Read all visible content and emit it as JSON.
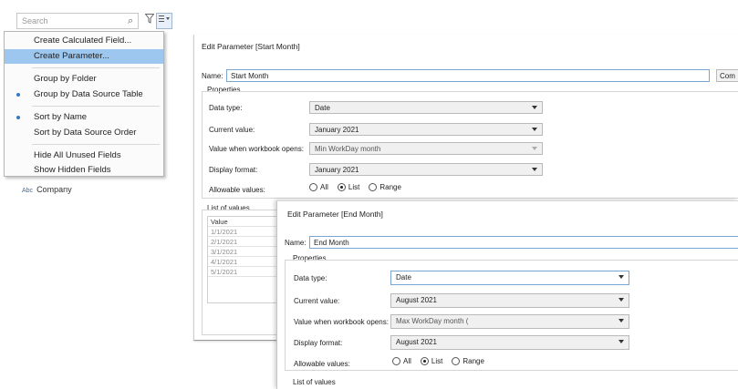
{
  "data_pane": {
    "search_placeholder": "Search",
    "search_icon": "magnifier-icon",
    "filter_icon": "filter-icon",
    "menu_icon": "list-menu-icon",
    "field": {
      "type_badge": "Abc",
      "name": "Company"
    }
  },
  "context_menu": {
    "items": [
      {
        "label": "Create Calculated Field...",
        "highlighted": false,
        "checked": false
      },
      {
        "label": "Create Parameter...",
        "highlighted": true,
        "checked": false
      },
      {
        "label": "Group by Folder",
        "highlighted": false,
        "checked": false
      },
      {
        "label": "Group by Data Source Table",
        "highlighted": false,
        "checked": true
      },
      {
        "label": "Sort by Name",
        "highlighted": false,
        "checked": true
      },
      {
        "label": "Sort by Data Source Order",
        "highlighted": false,
        "checked": false
      },
      {
        "label": "Hide All Unused Fields",
        "highlighted": false,
        "checked": false
      },
      {
        "label": "Show Hidden Fields",
        "highlighted": false,
        "checked": false
      }
    ]
  },
  "dialog_start": {
    "title": "Edit Parameter [Start Month]",
    "name_label": "Name:",
    "name_value": "Start Month",
    "comment_button": "Com",
    "properties_label": "Properties",
    "data_type_label": "Data type:",
    "data_type_value": "Date",
    "current_value_label": "Current value:",
    "current_value": "January 2021",
    "workbook_opens_label": "Value when workbook opens:",
    "workbook_opens_value": "Min WorkDay month",
    "display_format_label": "Display format:",
    "display_format_value": "January 2021",
    "allowable_label": "Allowable values:",
    "allowable_options": [
      "All",
      "List",
      "Range"
    ],
    "allowable_selected": "List",
    "list_of_values_label": "List of values",
    "list_header": "Value",
    "list_values": [
      "1/1/2021",
      "2/1/2021",
      "3/1/2021",
      "4/1/2021",
      "5/1/2021"
    ]
  },
  "dialog_end": {
    "title": "Edit Parameter [End Month]",
    "name_label": "Name:",
    "name_value": "End Month",
    "properties_label": "Properties",
    "data_type_label": "Data type:",
    "data_type_value": "Date",
    "current_value_label": "Current value:",
    "current_value": "August 2021",
    "workbook_opens_label": "Value when workbook opens:",
    "workbook_opens_value": "Max WorkDay month (",
    "display_format_label": "Display format:",
    "display_format_value": "August 2021",
    "allowable_label": "Allowable values:",
    "allowable_options": [
      "All",
      "List",
      "Range"
    ],
    "allowable_selected": "List",
    "list_of_values_label": "List of values"
  }
}
